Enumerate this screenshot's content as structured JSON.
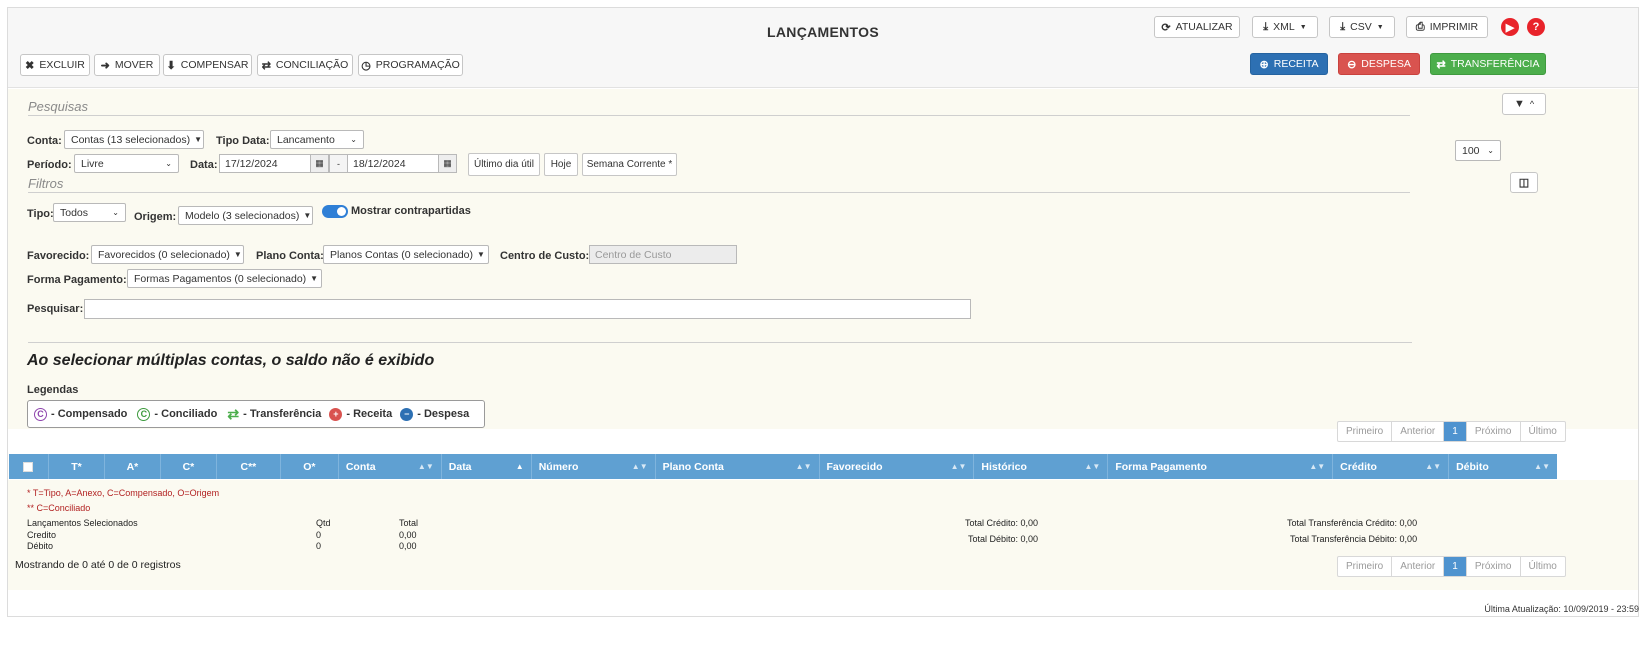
{
  "page": {
    "title": "LANÇAMENTOS",
    "last_update": "Última Atualização: 10/09/2019 - 23:59"
  },
  "toolbar_left": [
    {
      "icon": "close-icon",
      "glyph": "✖",
      "label": "EXCLUIR"
    },
    {
      "icon": "arrow-right-circle-icon",
      "glyph": "➜",
      "label": "MOVER"
    },
    {
      "icon": "download-circle-icon",
      "glyph": "⬇",
      "label": "COMPENSAR"
    },
    {
      "icon": "retweet-icon",
      "glyph": "⇄",
      "label": "CONCILIAÇÃO"
    },
    {
      "icon": "clock-icon",
      "glyph": "◷",
      "label": "PROGRAMAÇÃO"
    }
  ],
  "toolbar_right": {
    "refresh": "ATUALIZAR",
    "xml": "XML",
    "csv": "CSV",
    "print": "IMPRIMIR",
    "receita": "RECEITA",
    "despesa": "DESPESA",
    "transferencia": "TRANSFERÊNCIA"
  },
  "colors": {
    "primary": "#2d70b3",
    "danger": "#d9534f",
    "success": "#4cae4c",
    "header_blue": "#5fa0d2",
    "panel_bg": "#fbfaf1"
  },
  "search": {
    "heading": "Pesquisas",
    "conta_label": "Conta:",
    "conta_value": "Contas (13 selecionados)",
    "tipo_data_label": "Tipo Data:",
    "tipo_data_value": "Lancamento",
    "periodo_label": "Período:",
    "periodo_value": "Livre",
    "data_label": "Data:",
    "data_from": "17/12/2024",
    "data_sep": "-",
    "data_to": "18/12/2024",
    "btn_ultimo": "Último dia útil",
    "btn_hoje": "Hoje",
    "btn_semana": "Semana Corrente *"
  },
  "filters": {
    "heading": "Filtros",
    "tipo_label": "Tipo:",
    "tipo_value": "Todos",
    "origem_label": "Origem:",
    "origem_value": "Modelo (3 selecionados)",
    "toggle_label": "Mostrar contrapartidas",
    "favorecido_label": "Favorecido:",
    "favorecido_value": "Favorecidos (0 selecionado)",
    "plano_label": "Plano Conta:",
    "plano_value": "Planos Contas (0 selecionado)",
    "centro_label": "Centro de Custo:",
    "centro_placeholder": "Centro de Custo",
    "forma_label": "Forma Pagamento:",
    "forma_value": "Formas Pagamentos (0 selecionado)",
    "pesquisar_label": "Pesquisar:",
    "pesquisar_value": ""
  },
  "page_size": "100",
  "warning": "Ao selecionar múltiplas contas, o saldo não é exibido",
  "legend": {
    "title": "Legendas",
    "compensado": "- Compensado",
    "conciliado": "- Conciliado",
    "transferencia": "- Transferência",
    "receita": "- Receita",
    "despesa": "- Despesa"
  },
  "pagination": {
    "first": "Primeiro",
    "prev": "Anterior",
    "current": "1",
    "next": "Próximo",
    "last": "Último"
  },
  "table": {
    "columns": [
      "T*",
      "A*",
      "C*",
      "C**",
      "O*",
      "Conta",
      "Data",
      "Número",
      "Plano Conta",
      "Favorecido",
      "Histórico",
      "Forma Pagamento",
      "Crédito",
      "Débito"
    ]
  },
  "notes": {
    "line1": "* T=Tipo, A=Anexo, C=Compensado, O=Origem",
    "line2": "** C=Conciliado"
  },
  "summary": {
    "selected_title": "Lançamentos Selecionados",
    "qtd_label": "Qtd",
    "total_label": "Total",
    "credito_label": "Credito",
    "credito_qtd": "0",
    "credito_total": "0,00",
    "debito_label": "Débito",
    "debito_qtd": "0",
    "debito_total": "0,00",
    "total_credito": "Total Crédito: 0,00",
    "total_debito": "Total Débito: 0,00",
    "total_transf_credito": "Total Transferência Crédito: 0,00",
    "total_transf_debito": "Total Transferência Débito: 0,00",
    "showing": "Mostrando de 0 até 0 de 0 registros"
  }
}
